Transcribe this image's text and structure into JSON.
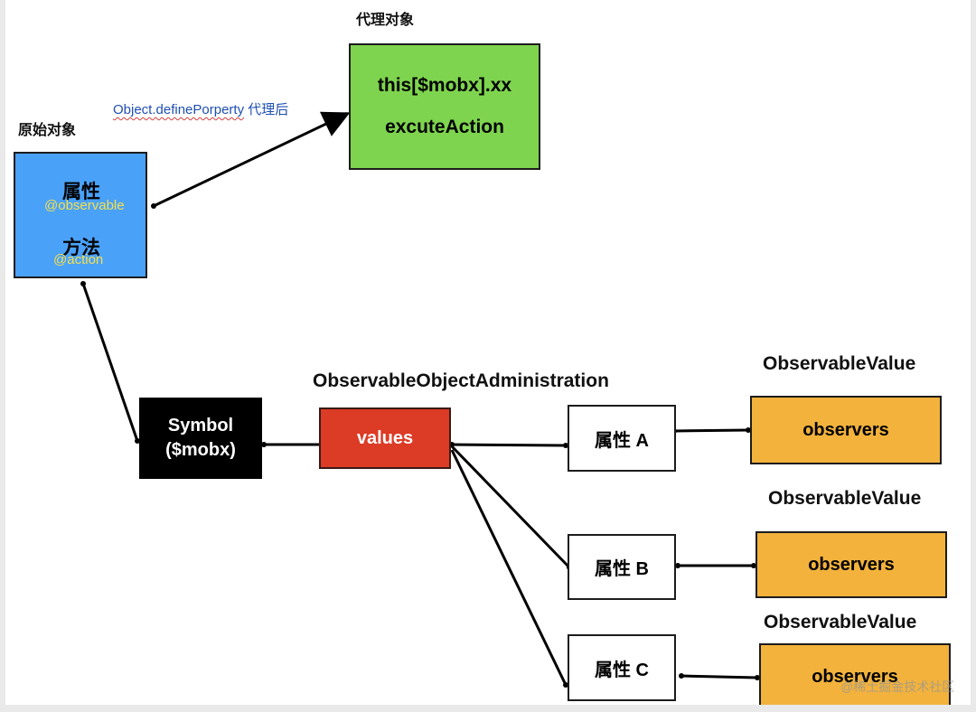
{
  "labels": {
    "proxy_title": "代理对象",
    "original_title": "原始对象",
    "define_property_prefix": "Object.definePorperty",
    "define_property_suffix": " 代理后",
    "admin_title": "ObservableObjectAdministration",
    "observable_value_a": "ObservableValue",
    "observable_value_b": "ObservableValue",
    "observable_value_c": "ObservableValue"
  },
  "proxy_box": {
    "line1": "this[$mobx].xx",
    "line2": "excuteAction"
  },
  "original_box": {
    "property": "属性",
    "property_decorator": "@observable",
    "method": "方法",
    "method_decorator": "@action"
  },
  "symbol_box": {
    "line1": "Symbol",
    "line2": "($mobx)"
  },
  "values_box": {
    "label": "values"
  },
  "properties": [
    "属性 A",
    "属性 B",
    "属性 C"
  ],
  "observers": [
    "observers",
    "observers",
    "observers"
  ],
  "watermark": "@稀土掘金技术社区",
  "colors": {
    "proxy_green": "#7ed44e",
    "original_blue": "#4aa1f8",
    "symbol_black": "#000000",
    "values_red": "#dc3b25",
    "observers_orange": "#f2b23c",
    "decorator_yellow": "#f4e04a",
    "link_blue": "#1f4fb3"
  }
}
